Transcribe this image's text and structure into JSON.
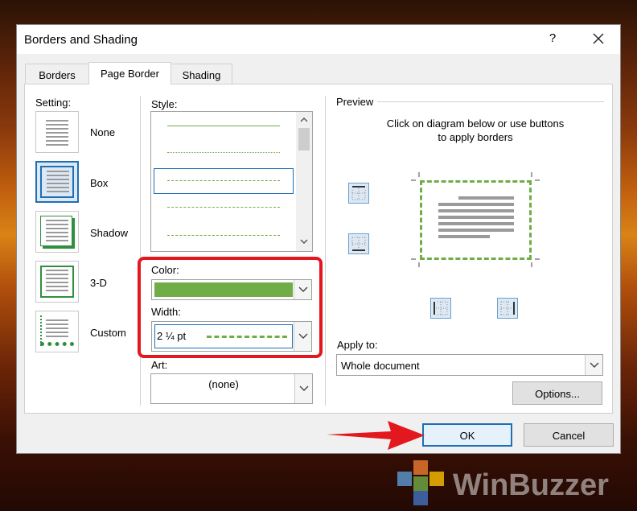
{
  "dialog": {
    "title": "Borders and Shading",
    "help_label": "?",
    "tabs": [
      {
        "label": "Borders",
        "active": false
      },
      {
        "label": "Page Border",
        "active": true
      },
      {
        "label": "Shading",
        "active": false
      }
    ]
  },
  "setting": {
    "label": "Setting:",
    "items": [
      {
        "label": "None",
        "selected": false
      },
      {
        "label": "Box",
        "selected": true
      },
      {
        "label": "Shadow",
        "selected": false
      },
      {
        "label": "3-D",
        "selected": false
      },
      {
        "label": "Custom",
        "selected": false
      }
    ]
  },
  "style": {
    "label": "Style:",
    "items": [
      "solid",
      "dotted",
      "dashed-small",
      "dashed",
      "dash-dot"
    ],
    "selected_index": 2
  },
  "color": {
    "label": "Color:",
    "value_color": "#70ad47"
  },
  "width": {
    "label": "Width:",
    "value": "2 ¼ pt"
  },
  "art": {
    "label": "Art:",
    "value": "(none)"
  },
  "preview": {
    "label": "Preview",
    "instructions_line1": "Click on diagram below or use buttons",
    "instructions_line2": "to apply borders",
    "border_color": "#70ad47",
    "buttons": [
      "top-border-icon",
      "bottom-border-icon",
      "left-border-icon",
      "right-border-icon"
    ]
  },
  "apply_to": {
    "label": "Apply to:",
    "value": "Whole document"
  },
  "buttons": {
    "options": "Options...",
    "ok": "OK",
    "cancel": "Cancel"
  },
  "annotations": {
    "highlight_color": "#e3181f",
    "arrow_color": "#e3181f"
  },
  "watermark": {
    "text": "WinBuzzer"
  }
}
